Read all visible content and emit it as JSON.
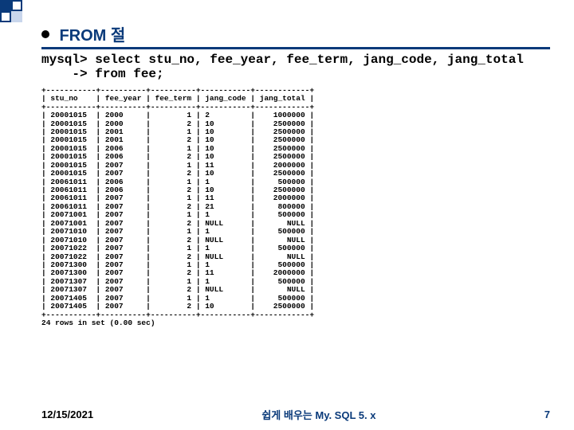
{
  "heading": "FROM 절",
  "sql_line1": "mysql> select stu_no, fee_year, fee_term, jang_code, jang_total",
  "sql_line2": "    -> from fee;",
  "columns": [
    "stu_no",
    "fee_year",
    "fee_term",
    "jang_code",
    "jang_total"
  ],
  "rows": [
    [
      "20001015",
      "2000",
      "1",
      "2",
      "1000000"
    ],
    [
      "20001015",
      "2000",
      "2",
      "10",
      "2500000"
    ],
    [
      "20001015",
      "2001",
      "1",
      "10",
      "2500000"
    ],
    [
      "20001015",
      "2001",
      "2",
      "10",
      "2500000"
    ],
    [
      "20001015",
      "2006",
      "1",
      "10",
      "2500000"
    ],
    [
      "20001015",
      "2006",
      "2",
      "10",
      "2500000"
    ],
    [
      "20001015",
      "2007",
      "1",
      "11",
      "2000000"
    ],
    [
      "20001015",
      "2007",
      "2",
      "10",
      "2500000"
    ],
    [
      "20061011",
      "2006",
      "1",
      "1",
      "500000"
    ],
    [
      "20061011",
      "2006",
      "2",
      "10",
      "2500000"
    ],
    [
      "20061011",
      "2007",
      "1",
      "11",
      "2000000"
    ],
    [
      "20061011",
      "2007",
      "2",
      "21",
      "800000"
    ],
    [
      "20071001",
      "2007",
      "1",
      "1",
      "500000"
    ],
    [
      "20071001",
      "2007",
      "2",
      "NULL",
      "NULL"
    ],
    [
      "20071010",
      "2007",
      "1",
      "1",
      "500000"
    ],
    [
      "20071010",
      "2007",
      "2",
      "NULL",
      "NULL"
    ],
    [
      "20071022",
      "2007",
      "1",
      "1",
      "500000"
    ],
    [
      "20071022",
      "2007",
      "2",
      "NULL",
      "NULL"
    ],
    [
      "20071300",
      "2007",
      "1",
      "1",
      "500000"
    ],
    [
      "20071300",
      "2007",
      "2",
      "11",
      "2000000"
    ],
    [
      "20071307",
      "2007",
      "1",
      "1",
      "500000"
    ],
    [
      "20071307",
      "2007",
      "2",
      "NULL",
      "NULL"
    ],
    [
      "20071405",
      "2007",
      "1",
      "1",
      "500000"
    ],
    [
      "20071405",
      "2007",
      "2",
      "10",
      "2500000"
    ]
  ],
  "summary": "24 rows in set (0.00 sec)",
  "footer_date": "12/15/2021",
  "footer_center": "쉽게 배우는 My. SQL 5. x",
  "page_number": "7",
  "chart_data": {
    "type": "table",
    "title": "mysql> select stu_no, fee_year, fee_term, jang_code, jang_total from fee;",
    "columns": [
      "stu_no",
      "fee_year",
      "fee_term",
      "jang_code",
      "jang_total"
    ],
    "rows": [
      [
        "20001015",
        "2000",
        "1",
        "2",
        "1000000"
      ],
      [
        "20001015",
        "2000",
        "2",
        "10",
        "2500000"
      ],
      [
        "20001015",
        "2001",
        "1",
        "10",
        "2500000"
      ],
      [
        "20001015",
        "2001",
        "2",
        "10",
        "2500000"
      ],
      [
        "20001015",
        "2006",
        "1",
        "10",
        "2500000"
      ],
      [
        "20001015",
        "2006",
        "2",
        "10",
        "2500000"
      ],
      [
        "20001015",
        "2007",
        "1",
        "11",
        "2000000"
      ],
      [
        "20001015",
        "2007",
        "2",
        "10",
        "2500000"
      ],
      [
        "20061011",
        "2006",
        "1",
        "1",
        "500000"
      ],
      [
        "20061011",
        "2006",
        "2",
        "10",
        "2500000"
      ],
      [
        "20061011",
        "2007",
        "1",
        "11",
        "2000000"
      ],
      [
        "20061011",
        "2007",
        "2",
        "21",
        "800000"
      ],
      [
        "20071001",
        "2007",
        "1",
        "1",
        "500000"
      ],
      [
        "20071001",
        "2007",
        "2",
        "NULL",
        "NULL"
      ],
      [
        "20071010",
        "2007",
        "1",
        "1",
        "500000"
      ],
      [
        "20071010",
        "2007",
        "2",
        "NULL",
        "NULL"
      ],
      [
        "20071022",
        "2007",
        "1",
        "1",
        "500000"
      ],
      [
        "20071022",
        "2007",
        "2",
        "NULL",
        "NULL"
      ],
      [
        "20071300",
        "2007",
        "1",
        "1",
        "500000"
      ],
      [
        "20071300",
        "2007",
        "2",
        "11",
        "2000000"
      ],
      [
        "20071307",
        "2007",
        "1",
        "1",
        "500000"
      ],
      [
        "20071307",
        "2007",
        "2",
        "NULL",
        "NULL"
      ],
      [
        "20071405",
        "2007",
        "1",
        "1",
        "500000"
      ],
      [
        "20071405",
        "2007",
        "2",
        "10",
        "2500000"
      ]
    ]
  }
}
